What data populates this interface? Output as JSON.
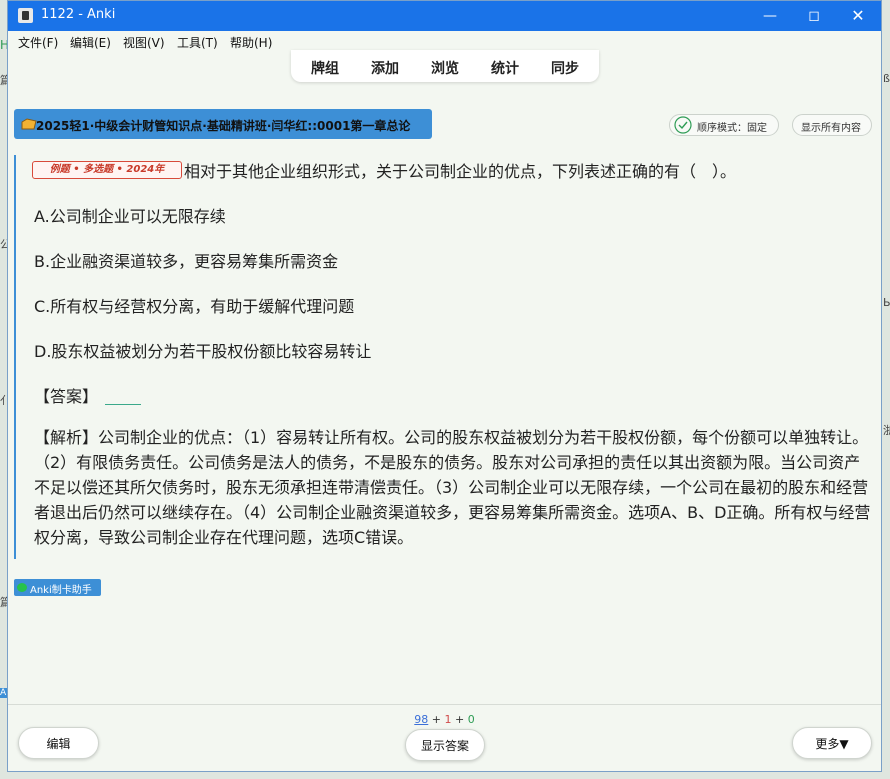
{
  "window": {
    "title": "1122 - Anki"
  },
  "menu": [
    {
      "label": "文件(F)"
    },
    {
      "label": "编辑(E)"
    },
    {
      "label": "视图(V)"
    },
    {
      "label": "工具(T)"
    },
    {
      "label": "帮助(H)"
    }
  ],
  "toolbar": {
    "decks": "牌组",
    "add": "添加",
    "browse": "浏览",
    "stats": "统计",
    "sync": "同步"
  },
  "deck_title": "2025轻1·中级会计财管知识点·基础精讲班·闫华红::0001第一章总论",
  "order_mode": "顺序模式：固定",
  "show_all": "显示所有内容",
  "card": {
    "stamp": "例题 • 多选题 • 2024年",
    "question": "相对于其他企业组织形式，关于公司制企业的优点，下列表述正确的有（　）。",
    "options": [
      "A.公司制企业可以无限存续",
      "B.企业融资渠道较多，更容易筹集所需资金",
      "C.所有权与经营权分离，有助于缓解代理问题",
      "D.股东权益被划分为若干股权份额比较容易转让"
    ],
    "answer_label": "【答案】",
    "explanation": "【解析】公司制企业的优点：（1）容易转让所有权。公司的股东权益被划分为若干股权份额，每个份额可以单独转让。（2）有限债务责任。公司债务是法人的债务，不是股东的债务。股东对公司承担的责任以其出资额为限。当公司资产不足以偿还其所欠债务时，股东无须承担连带清偿责任。（3）公司制企业可以无限存续，一个公司在最初的股东和经营者退出后仍然可以继续存在。（4）公司制企业融资渠道较多，更容易筹集所需资金。选项A、B、D正确。所有权与经营权分离，导致公司制企业存在代理问题，选项C错误。"
  },
  "helper": "Anki制卡助手",
  "counts": {
    "new": "98",
    "sep1": " + ",
    "learn": "1",
    "sep2": " + ",
    "review": "0"
  },
  "buttons": {
    "edit": "编辑",
    "show_answer": "显示答案",
    "more": "更多▼"
  },
  "background_fragments": [
    "H",
    "篇",
    "公",
    "亻",
    "篇",
    "A",
    "ß",
    "Ы",
    "浙"
  ],
  "colors": {
    "accent": "#3d8fd6",
    "titlebar": "#1a73e8",
    "new": "#3b6fd8",
    "learn": "#d14b4b",
    "review": "#2e9c55"
  }
}
